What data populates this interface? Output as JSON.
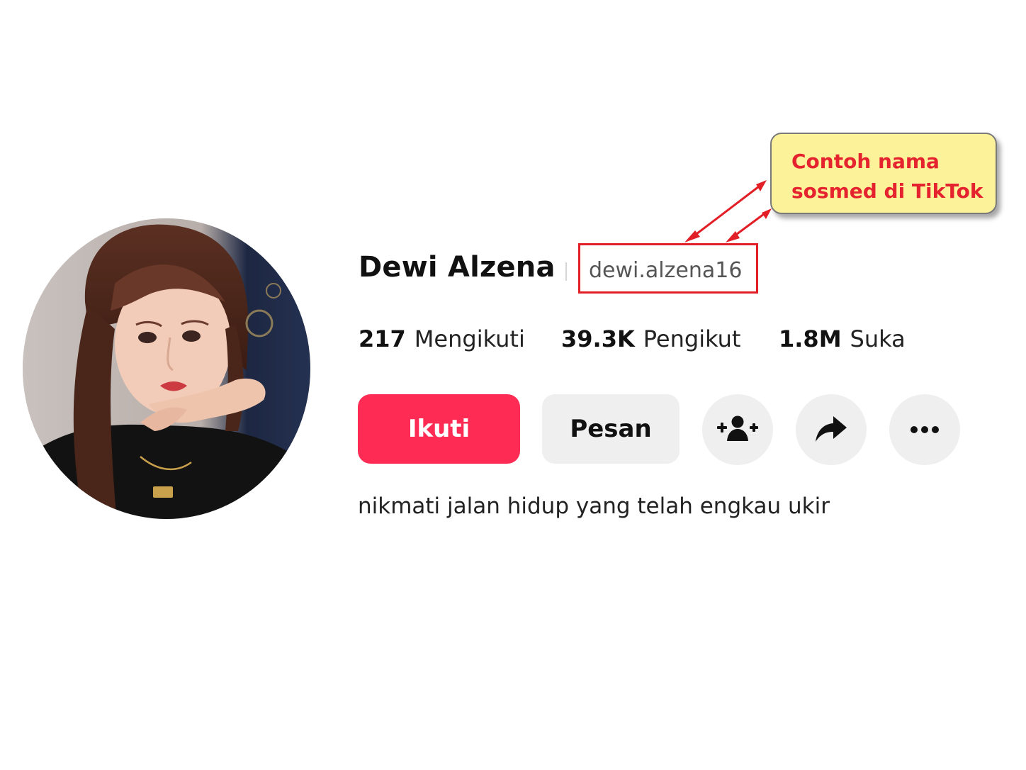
{
  "profile": {
    "display_name": "Dewi Alzena",
    "username": "dewi.alzena16",
    "bio": "nikmati jalan hidup yang telah engkau ukir"
  },
  "stats": [
    {
      "value": "217",
      "label": "Mengikuti"
    },
    {
      "value": "39.3K",
      "label": "Pengikut"
    },
    {
      "value": "1.8M",
      "label": "Suka"
    }
  ],
  "actions": {
    "follow_label": "Ikuti",
    "message_label": "Pesan",
    "icons": [
      "add-friend-icon",
      "share-icon",
      "more-icon"
    ]
  },
  "annotation": {
    "line1": "Contoh nama",
    "line2": "sosmed di TikTok"
  },
  "colors": {
    "accent": "#fe2c55",
    "button_gray": "#efefef",
    "annotation_red": "#e21f26",
    "annotation_bg": "#fcf29a"
  }
}
